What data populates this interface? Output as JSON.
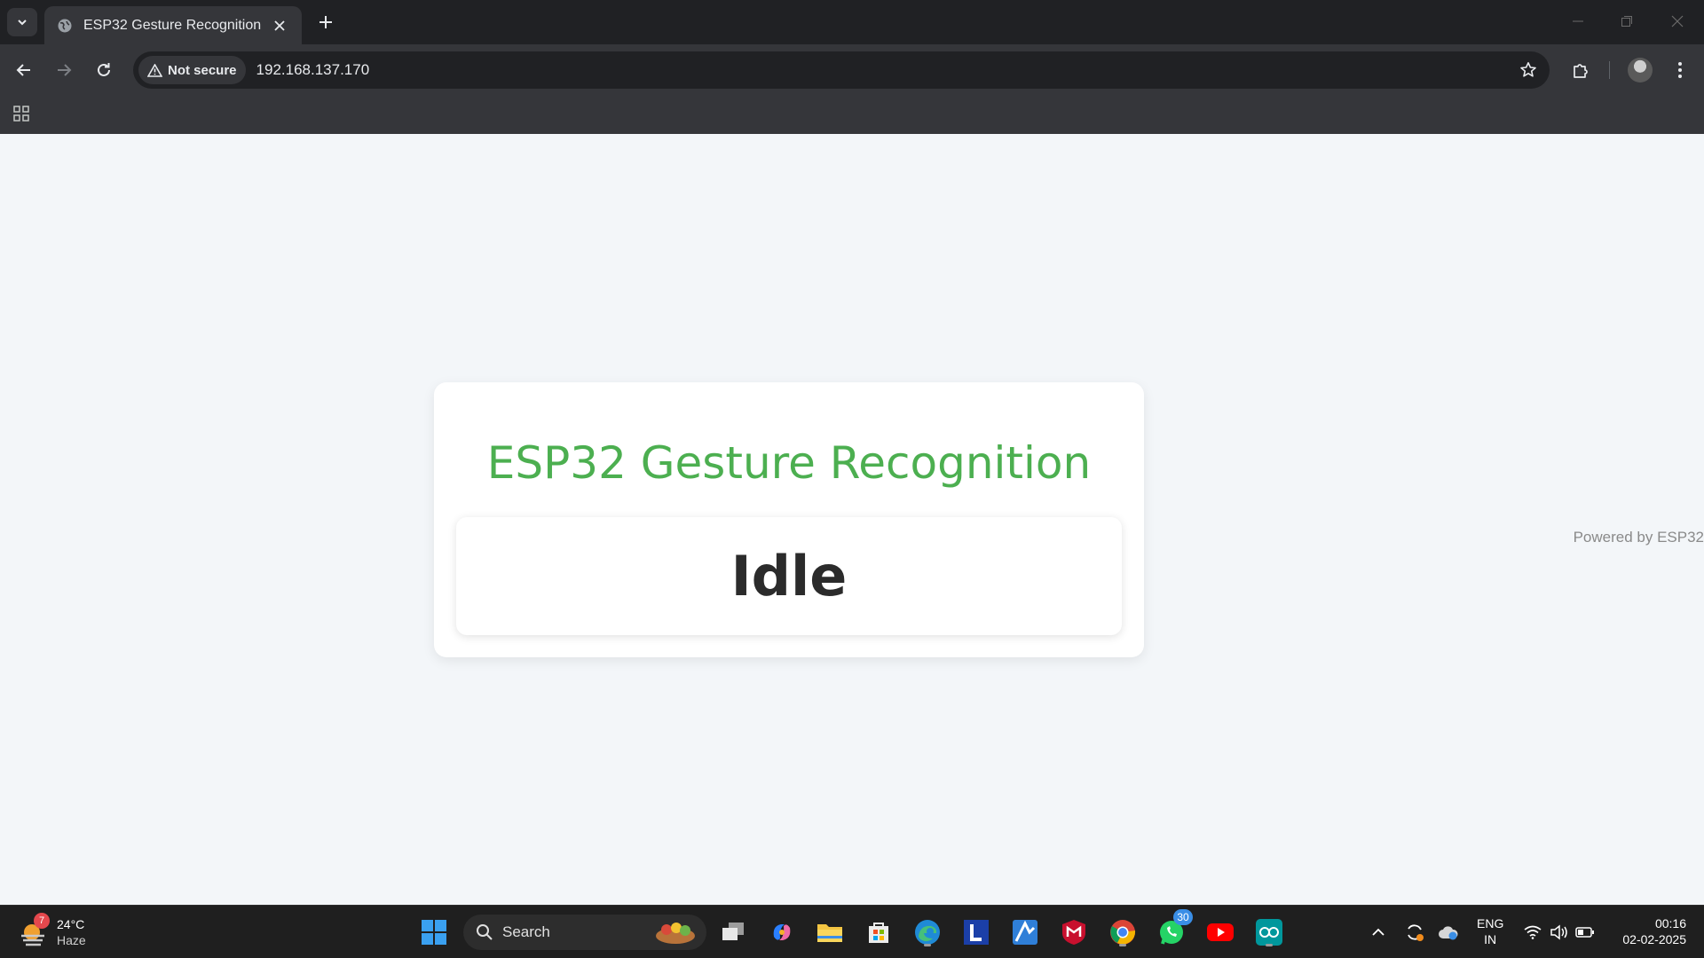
{
  "browser": {
    "tab": {
      "title": "ESP32 Gesture Recognition"
    },
    "security": {
      "label": "Not secure"
    },
    "url": "192.168.137.170"
  },
  "page": {
    "title": "ESP32 Gesture Recognition",
    "status": "Idle",
    "footer": "Powered by ESP32",
    "colors": {
      "title": "#4caf50",
      "background": "#f3f6f9"
    }
  },
  "taskbar": {
    "weather": {
      "temp": "24°C",
      "condition": "Haze",
      "badge": "7"
    },
    "search_label": "Search",
    "whatsapp_badge": "30",
    "lang": {
      "line1": "ENG",
      "line2": "IN"
    },
    "clock": {
      "time": "00:16",
      "date": "02-02-2025"
    }
  }
}
